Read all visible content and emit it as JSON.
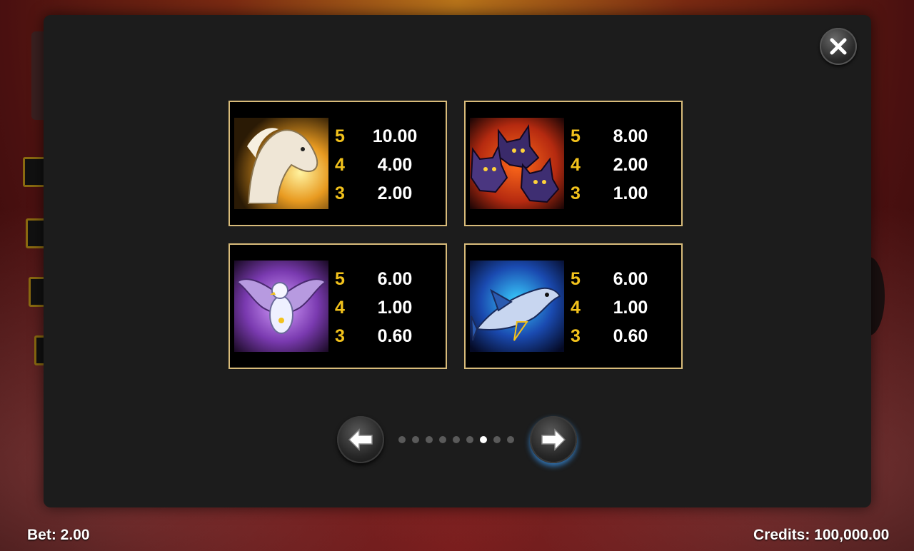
{
  "footer": {
    "bet_label": "Bet: 2.00",
    "credits_label": "Credits: 100,000.00"
  },
  "dialog": {
    "close_icon": "close-icon",
    "pagination": {
      "total_pages": 9,
      "current_page": 7
    },
    "nav": {
      "prev_icon": "arrow-left-icon",
      "next_icon": "arrow-right-icon"
    }
  },
  "paytable": [
    {
      "symbol": "pegasus-horse",
      "rows": [
        {
          "count": "5",
          "value": "10.00"
        },
        {
          "count": "4",
          "value": "4.00"
        },
        {
          "count": "3",
          "value": "2.00"
        }
      ]
    },
    {
      "symbol": "cerberus-dogs",
      "rows": [
        {
          "count": "5",
          "value": "8.00"
        },
        {
          "count": "4",
          "value": "2.00"
        },
        {
          "count": "3",
          "value": "1.00"
        }
      ]
    },
    {
      "symbol": "eagle",
      "rows": [
        {
          "count": "5",
          "value": "6.00"
        },
        {
          "count": "4",
          "value": "1.00"
        },
        {
          "count": "3",
          "value": "0.60"
        }
      ]
    },
    {
      "symbol": "shark",
      "rows": [
        {
          "count": "5",
          "value": "6.00"
        },
        {
          "count": "4",
          "value": "1.00"
        },
        {
          "count": "3",
          "value": "0.60"
        }
      ]
    }
  ],
  "colors": {
    "count": "#f2c21c",
    "value": "#ffffff",
    "card_border": "#d8bb7a",
    "dialog_bg": "#1c1c1c"
  }
}
